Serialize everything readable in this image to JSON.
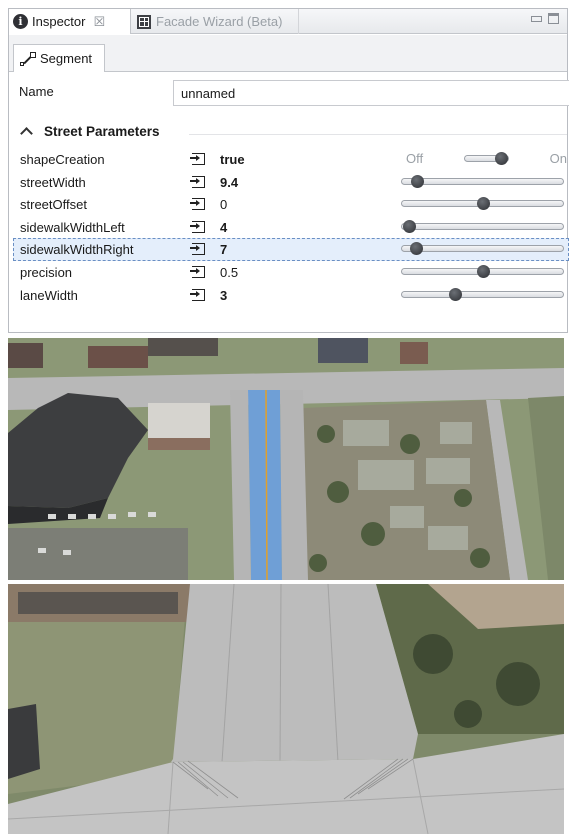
{
  "tabs": {
    "inspector_label": "Inspector",
    "facade_label": "Facade Wizard (Beta)",
    "close_glyph": "☒",
    "segment_label": "Segment"
  },
  "name_field": {
    "label": "Name",
    "value": "unnamed"
  },
  "section": {
    "title": "Street Parameters"
  },
  "shape_creation": {
    "name": "shapeCreation",
    "value": "true",
    "off_label": "Off",
    "on_label": "On",
    "state": "on"
  },
  "params": [
    {
      "name": "streetWidth",
      "value": "9.4",
      "bold": true,
      "slider_fraction": 0.1
    },
    {
      "name": "streetOffset",
      "value": "0",
      "bold": false,
      "slider_fraction": 0.5
    },
    {
      "name": "sidewalkWidthLeft",
      "value": "4",
      "bold": true,
      "slider_fraction": 0.05
    },
    {
      "name": "sidewalkWidthRight",
      "value": "7",
      "bold": true,
      "slider_fraction": 0.09
    },
    {
      "name": "precision",
      "value": "0.5",
      "bold": false,
      "slider_fraction": 0.5
    },
    {
      "name": "laneWidth",
      "value": "3",
      "bold": true,
      "slider_fraction": 0.33
    }
  ],
  "selected_param": "sidewalkWidthRight",
  "colors": {
    "selected_row": "#e4eefb",
    "street_highlight": "#6f9fd6",
    "center_line": "#e2a02a",
    "asphalt": "#b9b9b9",
    "grass": "#7c8c64"
  }
}
